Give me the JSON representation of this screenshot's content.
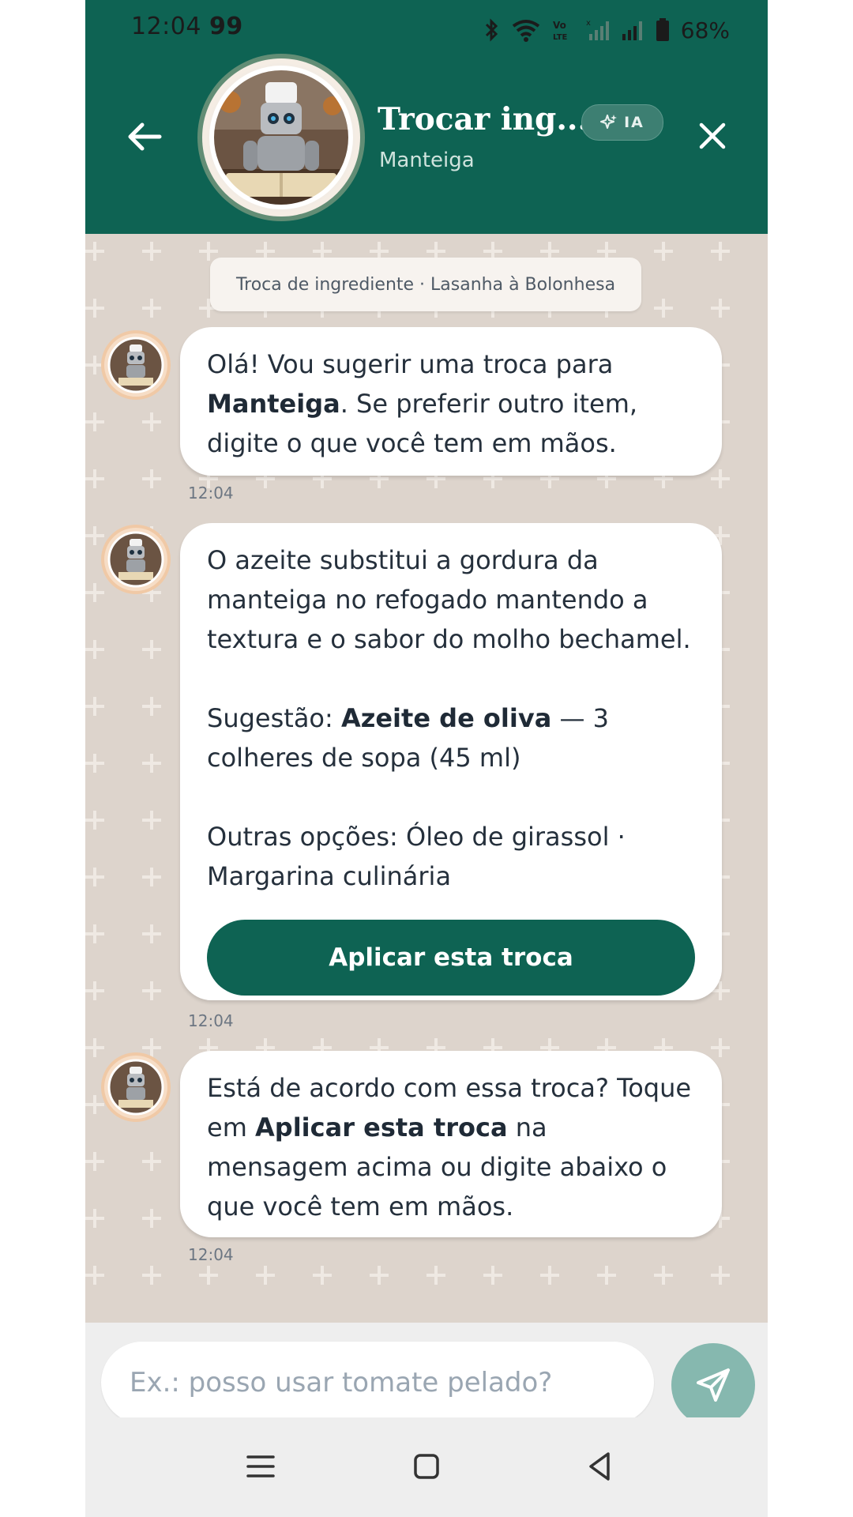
{
  "status_bar": {
    "time": "12:04",
    "notif_count": "99",
    "battery_percent": "68%"
  },
  "header": {
    "title": "Trocar ing...",
    "subtitle": "Manteiga",
    "ai_badge_label": "IA",
    "back_icon": "arrow-left-icon",
    "close_icon": "close-icon",
    "colors": {
      "background": "#0e6353",
      "badge_bg": "#3d7f72"
    }
  },
  "chat": {
    "context_chip": "Troca de ingrediente · Lasanha à Bolonhesa",
    "messages": [
      {
        "time": "12:04",
        "part1": "Olá! Vou sugerir uma troca para ",
        "bold": "Manteiga",
        "part2": ". Se preferir outro item, digite o que você tem em mãos."
      },
      {
        "time": "12:04",
        "intro": "O azeite substitui a gordura da manteiga no refogado mantendo a textura e o sabor do molho bechamel.",
        "suggestion_prefix": "Sugestão: ",
        "suggestion_bold": "Azeite de oliva",
        "suggestion_suffix": " — 3 colheres de sopa (45 ml)",
        "others": "Outras opções: Óleo de girassol · Margarina culinária",
        "button_label": "Aplicar esta troca"
      },
      {
        "time": "12:04",
        "part1": "Está de acordo com essa troca? Toque em ",
        "bold": "Aplicar esta troca",
        "part2": " na mensagem acima ou digite abaixo o que você tem em mãos."
      }
    ]
  },
  "composer": {
    "placeholder": "Ex.: posso usar tomate pelado?",
    "value": "",
    "send_icon": "send-icon",
    "send_color": "#86b8af"
  },
  "nav_bar": {
    "icons": [
      "menu-icon",
      "home-square-icon",
      "back-triangle-icon"
    ]
  }
}
